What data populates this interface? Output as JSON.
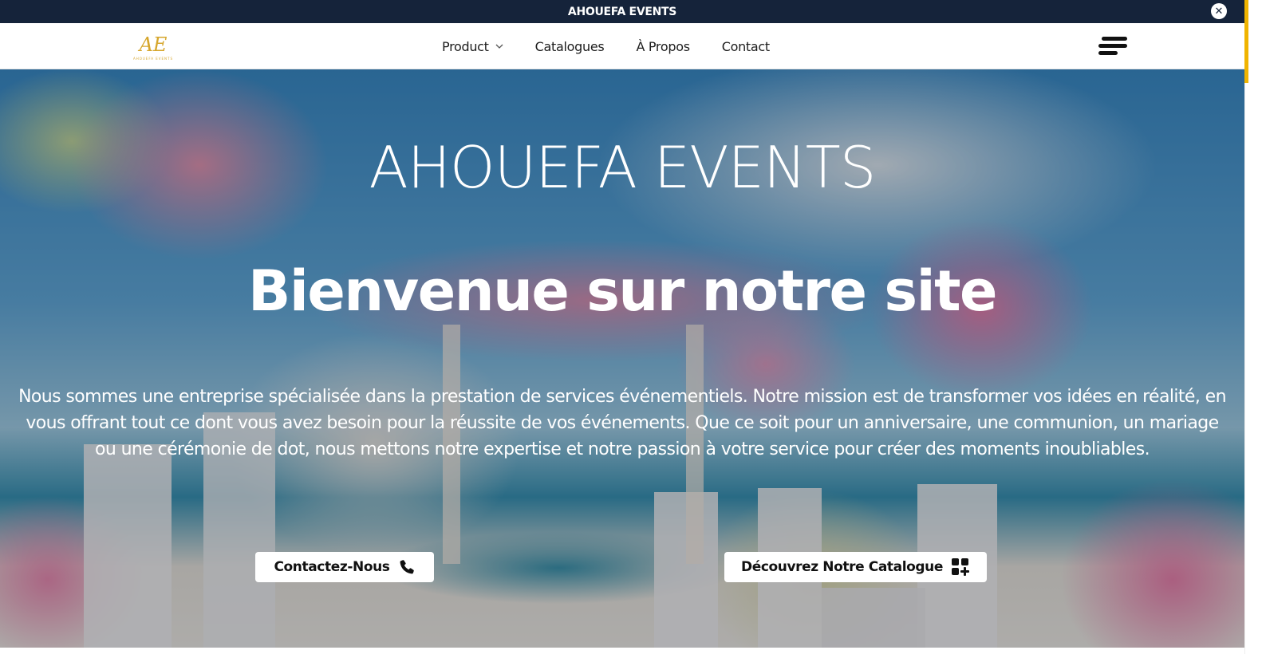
{
  "announcement": {
    "text": "AHOUEFA EVENTS",
    "close_symbol": "✕"
  },
  "header": {
    "logo_mark": "AE",
    "logo_sub": "AHOUEFA EVENTS",
    "nav": [
      {
        "label": "Product",
        "has_dropdown": true
      },
      {
        "label": "Catalogues"
      },
      {
        "label": "À Propos"
      },
      {
        "label": "Contact"
      }
    ],
    "menu_icon": "menu-icon"
  },
  "hero": {
    "brand": "AHOUEFA EVENTS",
    "welcome": "Bienvenue sur notre site",
    "description": "Nous sommes une entreprise spécialisée dans la prestation de services événementiels. Notre mission est de transformer vos idées en réalité, en vous offrant tout ce dont vous avez besoin pour la réussite de vos événements. Que ce soit pour un anniversaire, une communion, un mariage ou une cérémonie de dot, nous mettons notre expertise et notre passion à votre service pour créer des moments inoubliables.",
    "buttons": {
      "contact_label": "Contactez-Nous",
      "contact_icon": "phone-icon",
      "catalog_label": "Découvrez Notre Catalogue",
      "catalog_icon": "grid-plus-icon"
    }
  },
  "colors": {
    "topbar_bg": "#15233a",
    "logo_gold": "#d6a62c",
    "scroll_accent": "#f0b400"
  }
}
